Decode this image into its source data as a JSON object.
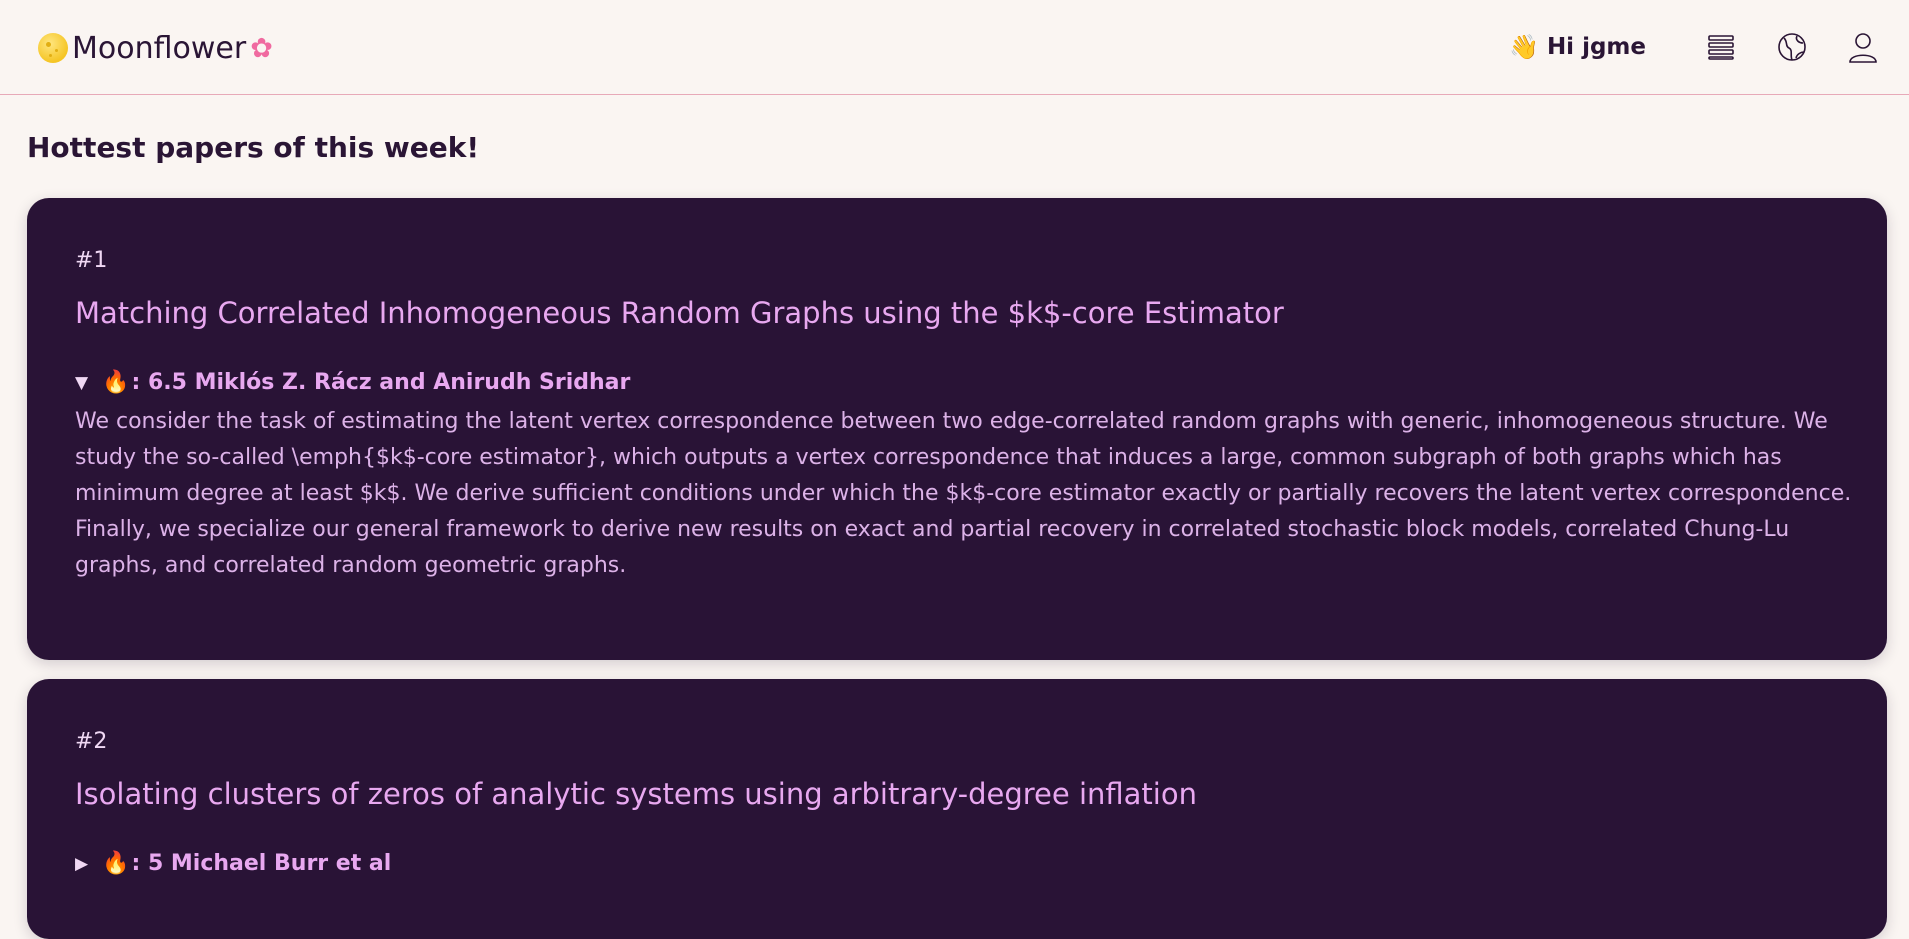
{
  "header": {
    "brand": "Moonflower",
    "greeting": "Hi jgme"
  },
  "page": {
    "heading": "Hottest papers of this week!"
  },
  "papers": [
    {
      "rank": "#1",
      "title": "Matching Correlated Inhomogeneous Random Graphs using the $k$-core Estimator",
      "expanded": true,
      "triangle": "▼",
      "score_line": ": 6.5 Miklós Z. Rácz and Anirudh Sridhar",
      "abstract": "We consider the task of estimating the latent vertex correspondence between two edge-correlated random graphs with generic, inhomogeneous structure. We study the so-called \\emph{$k$-core estimator}, which outputs a vertex correspondence that induces a large, common subgraph of both graphs which has minimum degree at least $k$. We derive sufficient conditions under which the $k$-core estimator exactly or partially recovers the latent vertex correspondence. Finally, we specialize our general framework to derive new results on exact and partial recovery in correlated stochastic block models, correlated Chung-Lu graphs, and correlated random geometric graphs."
    },
    {
      "rank": "#2",
      "title": "Isolating clusters of zeros of analytic systems using arbitrary-degree inflation",
      "expanded": false,
      "triangle": "▶",
      "score_line": ": 5 Michael Burr et al"
    }
  ]
}
